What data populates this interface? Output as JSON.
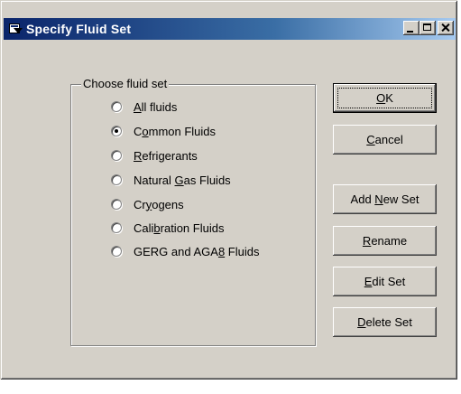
{
  "window": {
    "title": "Specify Fluid Set",
    "buttons": {
      "minimize": "minimize",
      "maximize": "maximize",
      "close": "close"
    }
  },
  "group": {
    "label": "Choose fluid set",
    "options": [
      {
        "pre": "",
        "key": "A",
        "post": "ll fluids",
        "checked": false
      },
      {
        "pre": "C",
        "key": "o",
        "post": "mmon Fluids",
        "checked": true
      },
      {
        "pre": "",
        "key": "R",
        "post": "efrigerants",
        "checked": false
      },
      {
        "pre": "Natural ",
        "key": "G",
        "post": "as Fluids",
        "checked": false
      },
      {
        "pre": "Cr",
        "key": "y",
        "post": "ogens",
        "checked": false
      },
      {
        "pre": "Cali",
        "key": "b",
        "post": "ration Fluids",
        "checked": false
      },
      {
        "pre": "GERG and AGA",
        "key": "8",
        "post": " Fluids",
        "checked": false
      }
    ]
  },
  "actions": {
    "ok": {
      "pre": "",
      "key": "O",
      "post": "K"
    },
    "cancel": {
      "pre": "",
      "key": "C",
      "post": "ancel"
    },
    "add_new": {
      "pre": "Add ",
      "key": "N",
      "post": "ew Set"
    },
    "rename": {
      "pre": "",
      "key": "R",
      "post": "ename"
    },
    "edit": {
      "pre": "",
      "key": "E",
      "post": "dit Set"
    },
    "delete": {
      "pre": "",
      "key": "D",
      "post": "elete Set"
    }
  },
  "colors": {
    "face": "#d4d0c8",
    "title_start": "#0a246a",
    "title_end": "#a6caf0"
  }
}
